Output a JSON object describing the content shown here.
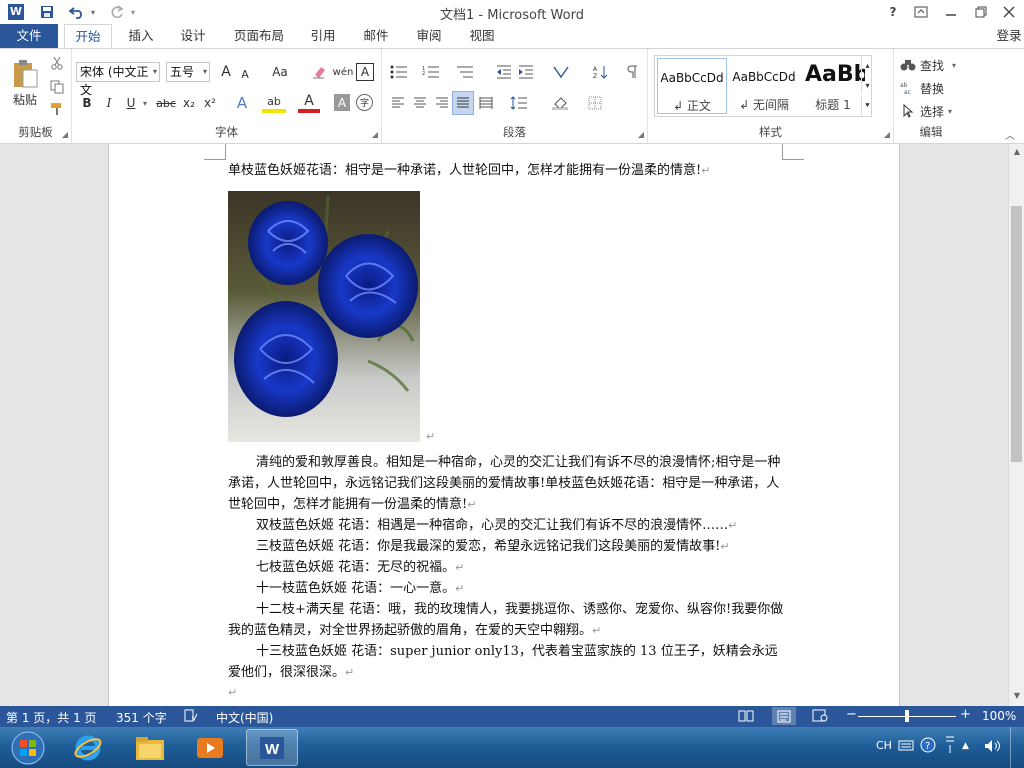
{
  "titlebar": {
    "title": "文档1 - Microsoft Word",
    "app_icon": "W",
    "save_icon": "save-icon",
    "undo_icon": "undo-icon",
    "redo_icon": "redo-icon",
    "help": "?"
  },
  "tabs": {
    "file": "文件",
    "items": [
      "开始",
      "插入",
      "设计",
      "页面布局",
      "引用",
      "邮件",
      "审阅",
      "视图"
    ],
    "login": "登录"
  },
  "ribbon": {
    "clipboard": {
      "paste": "粘贴",
      "label": "剪贴板"
    },
    "font": {
      "font_name": "宋体 (中文正文",
      "font_size": "五号",
      "grow": "A",
      "shrink": "A",
      "change_case": "Aa",
      "clear": "清除格式",
      "phonetic": "wén",
      "border_char": "A",
      "bold": "B",
      "italic": "I",
      "underline": "U",
      "strike": "abc",
      "subscript": "x₂",
      "superscript": "x²",
      "effects": "A",
      "highlight": "ab",
      "font_color": "A",
      "shade": "A",
      "enclose": "字",
      "label": "字体"
    },
    "paragraph": {
      "label": "段落"
    },
    "styles": {
      "items": [
        {
          "sample": "AaBbCcDd",
          "name": "↲ 正文"
        },
        {
          "sample": "AaBbCcDd",
          "name": "↲ 无间隔"
        },
        {
          "sample": "AaBb",
          "name": "标题 1"
        }
      ],
      "label": "样式"
    },
    "editing": {
      "find": "查找",
      "replace": "替换",
      "select": "选择",
      "label": "编辑"
    }
  },
  "document": {
    "line1": "单枝蓝色妖姬花语：相守是一种承诺，人世轮回中，怎样才能拥有一份温柔的情意!",
    "p1": "清纯的爱和敦厚善良。相知是一种宿命，心灵的交汇让我们有诉不尽的浪漫情怀;相守是一种承诺，人世轮回中，永远铭记我们这段美丽的爱情故事!单枝蓝色妖姬花语：相守是一种承诺，人世轮回中，怎样才能拥有一份温柔的情意!",
    "p2": "双枝蓝色妖姬 花语：相遇是一种宿命，心灵的交汇让我们有诉不尽的浪漫情怀……",
    "p3": "三枝蓝色妖姬 花语：你是我最深的爱恋，希望永远铭记我们这段美丽的爱情故事!",
    "p4": "七枝蓝色妖姬 花语：无尽的祝福。",
    "p5": "十一枝蓝色妖姬 花语：一心一意。",
    "p6": "十二枝+满天星 花语：哦，我的玫瑰情人，我要挑逗你、诱惑你、宠爱你、纵容你!我要你做我的蓝色精灵，对全世界扬起骄傲的眉角，在爱的天空中翱翔。",
    "p7": "十三枝蓝色妖姬 花语：super junior only13，代表着宝蓝家族的 13 位王子，妖精会永远爱他们，很深很深。",
    "return_mark": "↵"
  },
  "statusbar": {
    "page": "第 1 页，共 1 页",
    "words": "351 个字",
    "language": "中文(中国)",
    "zoom_minus": "−",
    "zoom_plus": "+",
    "zoom": "100%",
    "zoom_level": 1.0
  },
  "taskbar": {
    "tray_lang": "CH"
  },
  "colors": {
    "word_blue": "#2b579a",
    "taskbar": "#1f5e98"
  }
}
